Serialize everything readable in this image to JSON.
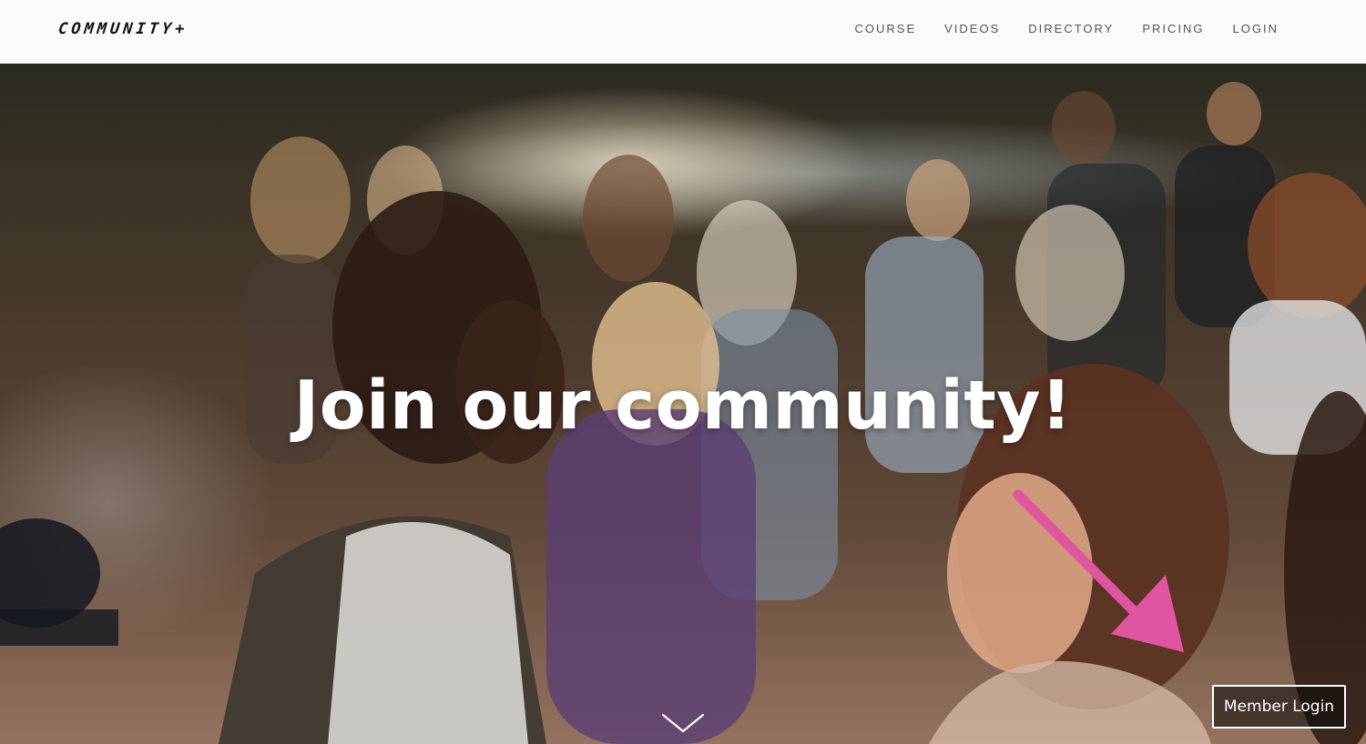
{
  "header": {
    "logo": "COMMUNITY+",
    "nav": [
      "COURSE",
      "VIDEOS",
      "DIRECTORY",
      "PRICING",
      "LOGIN"
    ]
  },
  "hero": {
    "title": "Join our community!",
    "member_login_label": "Member Login",
    "scroll_icon": "chevron-down-icon",
    "annotation_icon": "arrow-icon",
    "annotation_color": "#e0559f"
  },
  "colors": {
    "header_bg": "#fafafa",
    "nav_text": "#555555",
    "hero_text": "#ffffff"
  }
}
